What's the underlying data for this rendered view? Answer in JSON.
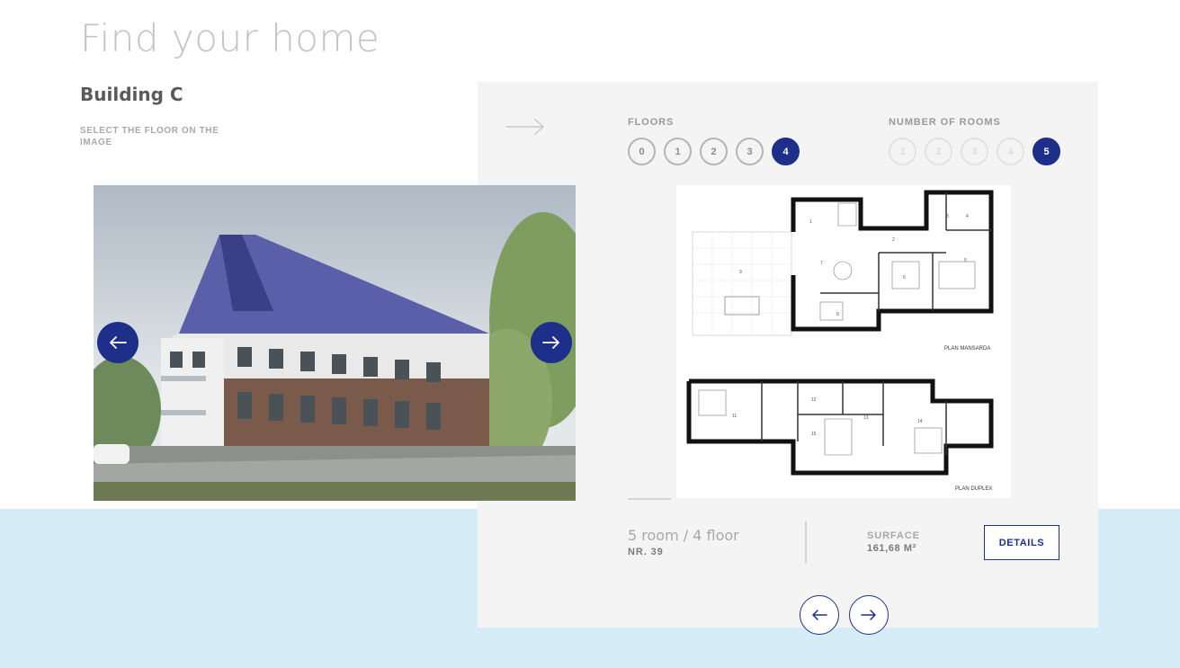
{
  "page": {
    "title": "Find your home"
  },
  "building": {
    "name": "Building C",
    "hint": "SELECT THE FLOOR ON THE IMAGE"
  },
  "floors": {
    "label": "FLOORS",
    "options": [
      "0",
      "1",
      "2",
      "3",
      "4"
    ],
    "selected": "4"
  },
  "rooms": {
    "label": "NUMBER OF ROOMS",
    "options": [
      "1",
      "2",
      "3",
      "4",
      "5"
    ],
    "selected": "5"
  },
  "plan": {
    "upper_caption": "PLAN MANSARDA",
    "lower_caption": "PLAN DUPLEX"
  },
  "unit": {
    "title": "5 room / 4 floor",
    "number": "NR. 39",
    "surface_label": "SURFACE",
    "surface_value": "161,68 M²",
    "details_label": "DETAILS"
  },
  "icons": {
    "carousel_prev": "arrow-left-icon",
    "carousel_next": "arrow-right-icon",
    "panel_arrow": "long-arrow-right-icon",
    "unit_prev": "arrow-left-icon",
    "unit_next": "arrow-right-icon"
  },
  "colors": {
    "accent": "#1e2f8a",
    "band": "#d6edf7",
    "panel": "#f4f4f4"
  }
}
